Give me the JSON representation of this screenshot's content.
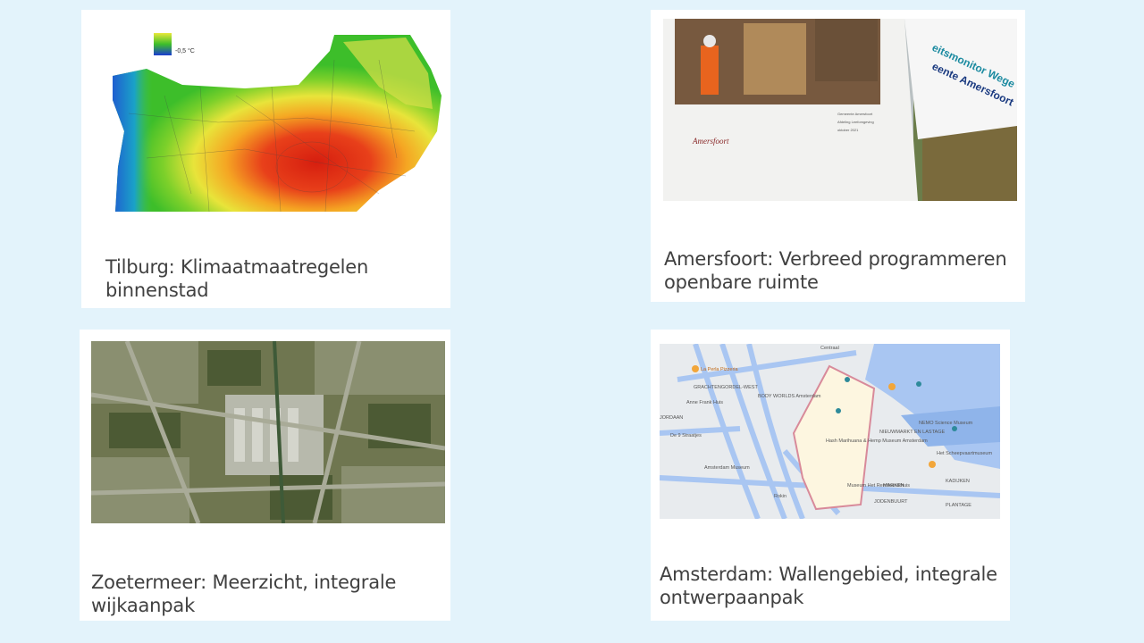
{
  "cards": [
    {
      "caption": "Tilburg: Klimaatmaatregelen binnenstad",
      "legend_label": "-0,5 °C"
    },
    {
      "caption": "Amersfoort: Verbreed programmeren openbare ruimte",
      "doc_title_1": "eitsmonitor Wege",
      "doc_title_2": "eente Amersfoort",
      "doc_logo": "Amersfoort",
      "doc_meta": [
        "Gemeente Amersfoort",
        "Afdeling Leefomgeving",
        "oktober 2021"
      ]
    },
    {
      "caption": "Zoetermeer: Meerzicht, integrale wijkaanpak"
    },
    {
      "caption": "Amsterdam: Wallengebied, integrale ontwerpaanpak",
      "map_labels": [
        "La Perla Pizzeria",
        "GRACHTENGORDEL-WEST",
        "Anne Frank Huis",
        "JORDAAN",
        "De 9 Straatjes",
        "Amsterdam Museum",
        "BODY WORLDS Amsterdam",
        "Hash Marihuana & Hemp Museum Amsterdam",
        "Museum Het Rembrandthuis",
        "NIEUWMARKT EN LASTAGE",
        "NEMO Science Museum",
        "Het Scheepvaartmuseum",
        "KADIJKEN",
        "MARKEN",
        "PLANTAGE",
        "JODENBUURT",
        "Rokin",
        "Centraal"
      ]
    }
  ]
}
